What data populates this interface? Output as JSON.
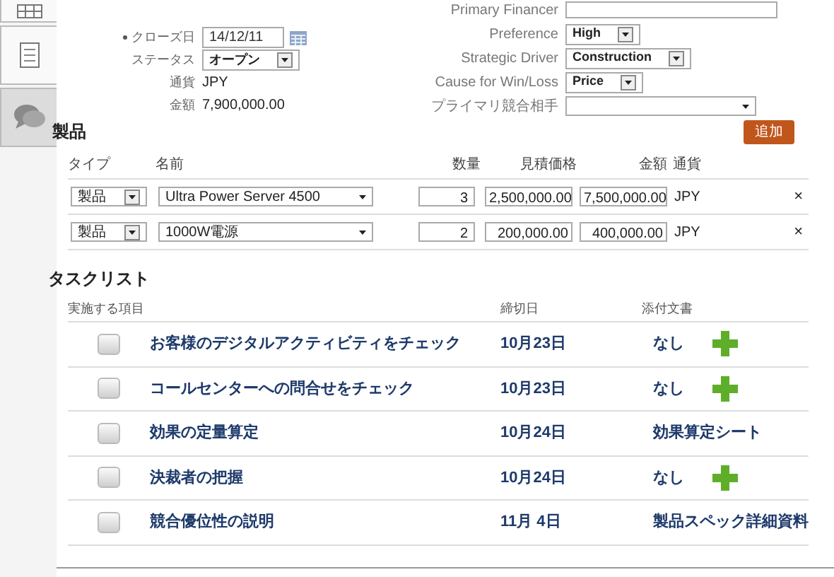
{
  "side_tabs": [
    {
      "selected": false
    },
    {
      "selected": false
    },
    {
      "selected": true
    }
  ],
  "form_left": [
    {
      "label": "クローズ日",
      "required": true,
      "kind": "date",
      "value": "14/12/11"
    },
    {
      "label": "ステータス",
      "required": false,
      "kind": "select",
      "value": "オープン"
    },
    {
      "label": "通貨",
      "required": false,
      "kind": "text",
      "value": "JPY"
    },
    {
      "label": "金額",
      "required": false,
      "kind": "text",
      "value": "7,900,000.00"
    }
  ],
  "form_right": [
    {
      "label": "Primary Financer",
      "kind": "input"
    },
    {
      "label": "Preference",
      "kind": "select",
      "value": "High"
    },
    {
      "label": "Strategic Driver",
      "kind": "select",
      "value": "Construction"
    },
    {
      "label": "Cause for Win/Loss",
      "kind": "select",
      "value": "Price"
    },
    {
      "label": "プライマリ競合相手",
      "kind": "combo"
    }
  ],
  "products": {
    "title": "製品",
    "add_button": "追加",
    "columns": [
      "タイプ",
      "名前",
      "数量",
      "見積価格",
      "金額",
      "通貨"
    ],
    "rows": [
      {
        "type": "製品",
        "name": "Ultra Power Server 4500",
        "quantity": "3",
        "price": "2,500,000.00",
        "amount": "7,500,000.00",
        "currency": "JPY",
        "remove": "×"
      },
      {
        "type": "製品",
        "name": "1000W電源",
        "quantity": "2",
        "price": "200,000.00",
        "amount": "400,000.00",
        "currency": "JPY",
        "remove": "×"
      }
    ]
  },
  "tasks": {
    "title": "タスクリスト",
    "columns": [
      "実施する項目",
      "締切日",
      "添付文書"
    ],
    "rows": [
      {
        "checked": false,
        "task": "お客様のデジタルアクティビティをチェック",
        "due": "10月23日",
        "attachment": "なし",
        "can_add": true
      },
      {
        "checked": false,
        "task": "コールセンターへの問合せをチェック",
        "due": "10月23日",
        "attachment": "なし",
        "can_add": true
      },
      {
        "checked": false,
        "task": "効果の定量算定",
        "due": "10月24日",
        "attachment": "効果算定シート",
        "can_add": false
      },
      {
        "checked": false,
        "task": "決裁者の把握",
        "due": "10月24日",
        "attachment": "なし",
        "can_add": true
      },
      {
        "checked": false,
        "task": "競合優位性の説明",
        "due": "11月 4日",
        "attachment": "製品スペック詳細資料",
        "can_add": false
      }
    ]
  }
}
